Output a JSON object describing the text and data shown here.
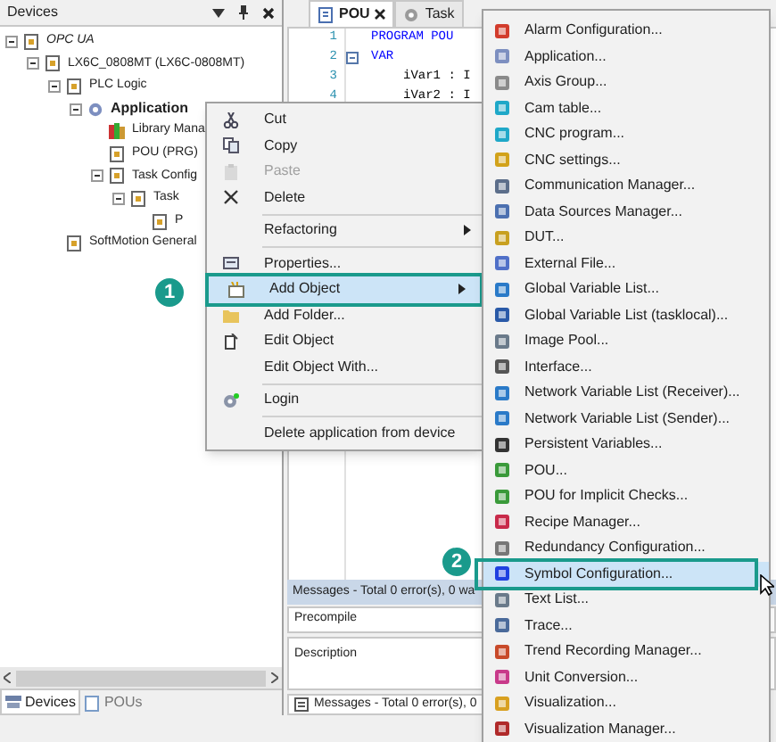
{
  "devices_panel": {
    "title": "Devices",
    "tree": [
      {
        "label": "OPC UA",
        "kind": "inactive",
        "expanded": true,
        "children": [
          {
            "label": "LX6C_0808MT (LX6C-0808MT)",
            "kind": "node",
            "expanded": true,
            "children": [
              {
                "label": "PLC Logic",
                "kind": "node",
                "expanded": true,
                "children": [
                  {
                    "label": "Application",
                    "kind": "active",
                    "expanded": true,
                    "children": [
                      {
                        "label": "Library Mana",
                        "kind": "node"
                      },
                      {
                        "label": "POU (PRG)",
                        "kind": "node"
                      },
                      {
                        "label": "Task Config",
                        "kind": "node",
                        "expanded": true,
                        "children": [
                          {
                            "label": "Task",
                            "kind": "node",
                            "expanded": true,
                            "children": [
                              {
                                "label": "P",
                                "kind": "node"
                              }
                            ]
                          }
                        ]
                      }
                    ]
                  }
                ]
              },
              {
                "label": "SoftMotion General",
                "kind": "node"
              }
            ]
          }
        ]
      }
    ],
    "tabs": [
      {
        "label": "Devices",
        "selected": true
      },
      {
        "label": "POUs",
        "selected": false
      }
    ]
  },
  "editor": {
    "tabs": [
      {
        "label": "POU",
        "selected": true
      },
      {
        "label": "Task",
        "selected": false
      }
    ],
    "lines": [
      {
        "number": "1",
        "code": "PROGRAM POU",
        "keyword": true
      },
      {
        "number": "2",
        "code": "VAR",
        "keyword": true
      },
      {
        "number": "3",
        "code": "iVar1 : I",
        "keyword": false
      },
      {
        "number": "4",
        "code": "iVar2 : I",
        "keyword": false
      }
    ]
  },
  "messages": {
    "header": "Messages - Total 0 error(s), 0 wa",
    "filter": "Precompile",
    "column": "Description",
    "tab": "Messages - Total 0 error(s), 0"
  },
  "context_menu": [
    {
      "label": "Cut",
      "disabled": false,
      "selected": false,
      "submenu": false
    },
    {
      "label": "Copy",
      "disabled": false,
      "selected": false,
      "submenu": false
    },
    {
      "label": "Paste",
      "disabled": true,
      "selected": false,
      "submenu": false
    },
    {
      "label": "Delete",
      "disabled": false,
      "selected": false,
      "submenu": false,
      "separator_after": true
    },
    {
      "label": "Refactoring",
      "disabled": false,
      "selected": false,
      "submenu": true,
      "separator_after": true
    },
    {
      "label": "Properties...",
      "disabled": false,
      "selected": false,
      "submenu": false
    },
    {
      "label": "Add Object",
      "disabled": false,
      "selected": true,
      "submenu": true
    },
    {
      "label": "Add Folder...",
      "disabled": false,
      "selected": false,
      "submenu": false
    },
    {
      "label": "Edit Object",
      "disabled": false,
      "selected": false,
      "submenu": false
    },
    {
      "label": "Edit Object With...",
      "disabled": false,
      "selected": false,
      "submenu": false,
      "separator_after": true
    },
    {
      "label": "Login",
      "disabled": false,
      "selected": false,
      "submenu": false,
      "separator_after": true
    },
    {
      "label": "Delete application from device",
      "disabled": false,
      "selected": false,
      "submenu": false
    }
  ],
  "add_object_menu": [
    {
      "label": "Alarm Configuration...",
      "selected": false
    },
    {
      "label": "Application...",
      "selected": false
    },
    {
      "label": "Axis Group...",
      "selected": false
    },
    {
      "label": "Cam table...",
      "selected": false
    },
    {
      "label": "CNC program...",
      "selected": false
    },
    {
      "label": "CNC settings...",
      "selected": false
    },
    {
      "label": "Communication Manager...",
      "selected": false
    },
    {
      "label": "Data Sources Manager...",
      "selected": false
    },
    {
      "label": "DUT...",
      "selected": false
    },
    {
      "label": "External File...",
      "selected": false
    },
    {
      "label": "Global Variable List...",
      "selected": false
    },
    {
      "label": "Global Variable List (tasklocal)...",
      "selected": false
    },
    {
      "label": "Image Pool...",
      "selected": false
    },
    {
      "label": "Interface...",
      "selected": false
    },
    {
      "label": "Network Variable List (Receiver)...",
      "selected": false
    },
    {
      "label": "Network Variable List (Sender)...",
      "selected": false
    },
    {
      "label": "Persistent Variables...",
      "selected": false
    },
    {
      "label": "POU...",
      "selected": false
    },
    {
      "label": "POU for Implicit Checks...",
      "selected": false
    },
    {
      "label": "Recipe Manager...",
      "selected": false
    },
    {
      "label": "Redundancy Configuration...",
      "selected": false
    },
    {
      "label": "Symbol Configuration...",
      "selected": true
    },
    {
      "label": "Text List...",
      "selected": false
    },
    {
      "label": "Trace...",
      "selected": false
    },
    {
      "label": "Trend Recording Manager...",
      "selected": false
    },
    {
      "label": "Unit Conversion...",
      "selected": false
    },
    {
      "label": "Visualization...",
      "selected": false
    },
    {
      "label": "Visualization Manager...",
      "selected": false
    }
  ],
  "step_badges": [
    "1",
    "2"
  ]
}
